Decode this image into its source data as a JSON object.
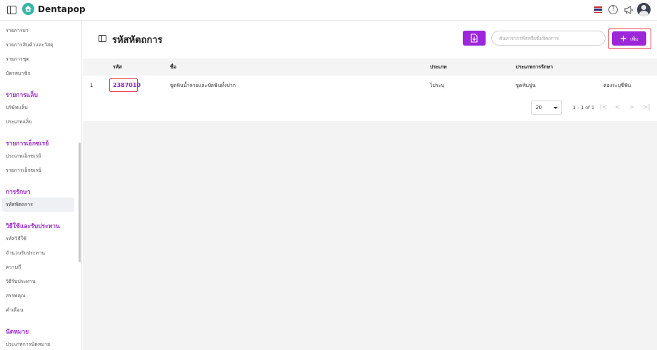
{
  "app": {
    "brand": "Dentapop",
    "icons": [
      "panel-toggle-icon",
      "tooth-logo-icon",
      "thai-flag-icon",
      "help-icon",
      "megaphone-icon",
      "user-avatar-icon"
    ]
  },
  "sidebar": {
    "items_top": [
      {
        "label": "รายการยา"
      },
      {
        "label": "รายการสินค้าและวัสดุ"
      },
      {
        "label": "รายการชุด"
      },
      {
        "label": "บัตรสมาชิก"
      }
    ],
    "lab": {
      "title": "รายการแล็บ",
      "items": [
        {
          "label": "บริษัทแล็บ"
        },
        {
          "label": "ประเภทแล็บ"
        }
      ]
    },
    "xray": {
      "title": "รายการเอ็กซเรย์",
      "items": [
        {
          "label": "ประเภทเอ็กซเรย์"
        },
        {
          "label": "รายการเอ็กซเรย์"
        }
      ]
    },
    "treatment": {
      "title": "การรักษา",
      "items": [
        {
          "label": "รหัสหัตถการ"
        }
      ]
    },
    "usage": {
      "title": "วิธีใช้และรับประทาน",
      "items": [
        {
          "label": "รหัสวิธีใช้"
        },
        {
          "label": "จำนวนรับประทาน"
        },
        {
          "label": "ความถี่"
        },
        {
          "label": "วิธีรับประทาน"
        },
        {
          "label": "สรรพคุณ"
        },
        {
          "label": "คำเตือน"
        }
      ]
    },
    "appointment": {
      "title": "นัดหมาย",
      "items": [
        {
          "label": "ประเภทการนัดหมาย"
        }
      ]
    }
  },
  "main": {
    "title": "รหัสหัตถการ",
    "search_placeholder": "ค้นหาจากรหัสหรือชื่อหัตถการ",
    "add_label": "เพิ่ม",
    "accent_color": "#9b27d9",
    "table": {
      "columns": [
        "รหัส",
        "ชื่อ",
        "ประเภท",
        "ประเภทการรักษา"
      ],
      "rows": [
        {
          "index": "1",
          "code": "2387010",
          "name": "ขูดหินน้ำลายและขัดฟันทั้งปาก",
          "type": "ไม่ระบุ",
          "treatment_type": "ขูดหินปูน",
          "action": "ต่องระบุซี่ฟัน"
        }
      ]
    },
    "pagination": {
      "page_size": "20",
      "range": "1 – 1 of 1",
      "first": "|<",
      "prev": "<",
      "next": ">",
      "last": ">|"
    }
  }
}
